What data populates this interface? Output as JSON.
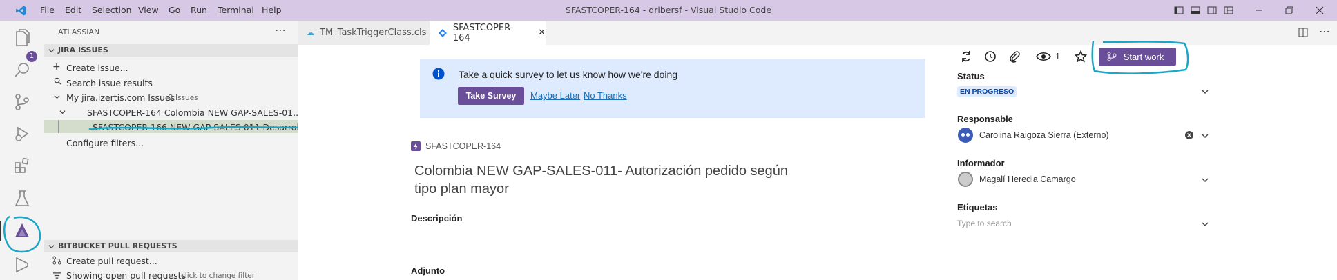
{
  "menu": [
    "File",
    "Edit",
    "Selection",
    "View",
    "Go",
    "Run",
    "Terminal",
    "Help"
  ],
  "window_title": "SFASTCOPER-164 - dribersf - Visual Studio Code",
  "activity": {
    "badge": "1"
  },
  "sidebar": {
    "title": "ATLASSIAN",
    "jira_section": "JIRA ISSUES",
    "create_issue": "Create issue...",
    "search_results": "Search issue results",
    "my_jira": "My jira.izertis.com Issues",
    "my_jira_count": "2 Issues",
    "issue_parent": "SFASTCOPER-164 Colombia NEW GAP-SALES-01...",
    "issue_child": "SFASTCOPER-166 NEW GAP SALES 011 Desarrollo",
    "configure_filters": "Configure filters...",
    "bitbucket_section": "BITBUCKET PULL REQUESTS",
    "create_pr": "Create pull request...",
    "showing_prs": "Showing open pull requests",
    "showing_prs_hint": "click to change filter"
  },
  "tabs": [
    {
      "label": "TM_TaskTriggerClass.cls",
      "modified": true
    },
    {
      "label": "SFASTCOPER-164",
      "active": true
    }
  ],
  "survey": {
    "message": "Take a quick survey to let us know how we're doing",
    "take": "Take Survey",
    "later": "Maybe Later",
    "no": "No Thanks"
  },
  "issue": {
    "key": "SFASTCOPER-164",
    "title": "Colombia NEW GAP-SALES-011- Autorización pedido según tipo plan mayor",
    "description_label": "Descripción",
    "attachment_label": "Adjunto"
  },
  "toolbar": {
    "watchers": "1",
    "start_work": "Start work"
  },
  "fields": {
    "status_label": "Status",
    "status_value": "EN PROGRESO",
    "assignee_label": "Responsable",
    "assignee_value": "Carolina Raigoza Sierra (Externo)",
    "reporter_label": "Informador",
    "reporter_value": "Magalí Heredia Camargo",
    "labels_label": "Etiquetas",
    "labels_placeholder": "Type to search"
  },
  "colors": {
    "titlebar": "#d7c8e6",
    "accent": "#6a4e9a",
    "annotation": "#1aa6c8"
  }
}
